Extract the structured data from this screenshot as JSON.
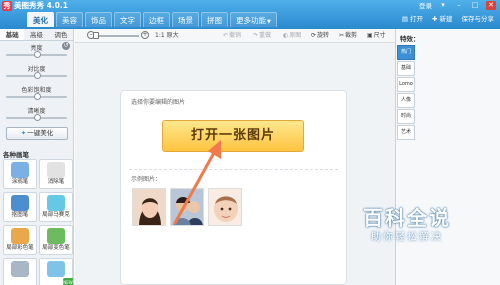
{
  "app": {
    "title": "美图秀秀 4.0.1",
    "logo_text": "秀",
    "login_label": "登录",
    "win_buttons": [
      "▾",
      "–",
      "□",
      "✕"
    ]
  },
  "tabs": [
    {
      "label": "美化",
      "active": true
    },
    {
      "label": "美容",
      "active": false
    },
    {
      "label": "饰品",
      "active": false
    },
    {
      "label": "文字",
      "active": false
    },
    {
      "label": "边框",
      "active": false
    },
    {
      "label": "场景",
      "active": false
    },
    {
      "label": "拼图",
      "active": false
    },
    {
      "label": "更多功能",
      "active": false
    }
  ],
  "top_actions": {
    "open": "打开",
    "new": "新建",
    "save_share": "保存与分享"
  },
  "left_panel": {
    "sub_tabs": [
      {
        "label": "基础",
        "active": true
      },
      {
        "label": "高级",
        "active": false
      },
      {
        "label": "调色",
        "active": false
      }
    ],
    "sliders": [
      {
        "label": "亮度",
        "value": 0.5
      },
      {
        "label": "对比度",
        "value": 0.5
      },
      {
        "label": "色彩饱和度",
        "value": 0.5
      },
      {
        "label": "清晰度",
        "value": 0.5
      }
    ],
    "reset_icon": "↺",
    "beautify_button": "一键美化",
    "brush_title": "各种画笔",
    "brushes": [
      {
        "label": "涂鸦笔",
        "color": "#7ab0e3",
        "is_new": false
      },
      {
        "label": "消除笔",
        "color": "#e2e2e2",
        "is_new": false
      },
      {
        "label": "抠图笔",
        "color": "#4d8fce",
        "is_new": false
      },
      {
        "label": "局部马赛克",
        "color": "#65c9e6",
        "is_new": false
      },
      {
        "label": "局部彩色笔",
        "color": "#e9a84a",
        "is_new": false
      },
      {
        "label": "局部变色笔",
        "color": "#6dbb5f",
        "is_new": false
      },
      {
        "label": "",
        "color": "#a8b6c6",
        "is_new": false
      },
      {
        "label": "",
        "color": "#7fc3e8",
        "is_new": true
      }
    ]
  },
  "toolbar": {
    "zoom_label": "1:1 原大",
    "undo": "撤销",
    "redo": "重做",
    "original": "原图",
    "rotate": "旋转",
    "crop": "裁剪",
    "size": "尺寸"
  },
  "canvas": {
    "hint": "选择你要编辑的图片",
    "open_button": "打开一张图片",
    "sample_label": "示例图片："
  },
  "right_panel": {
    "title": "特效：",
    "effect_tabs": [
      {
        "label": "热门",
        "active": true
      },
      {
        "label": "基础",
        "active": false
      },
      {
        "label": "Lomo",
        "active": false
      },
      {
        "label": "人像",
        "active": false
      },
      {
        "label": "时尚",
        "active": false
      },
      {
        "label": "艺术",
        "active": false
      }
    ]
  },
  "watermark": {
    "main": "百科全说",
    "sub": "助你轻松解决"
  },
  "colors": {
    "accent": "#2b89cf",
    "button_yellow": "#ffc43f",
    "arrow": "#f07a4a"
  }
}
